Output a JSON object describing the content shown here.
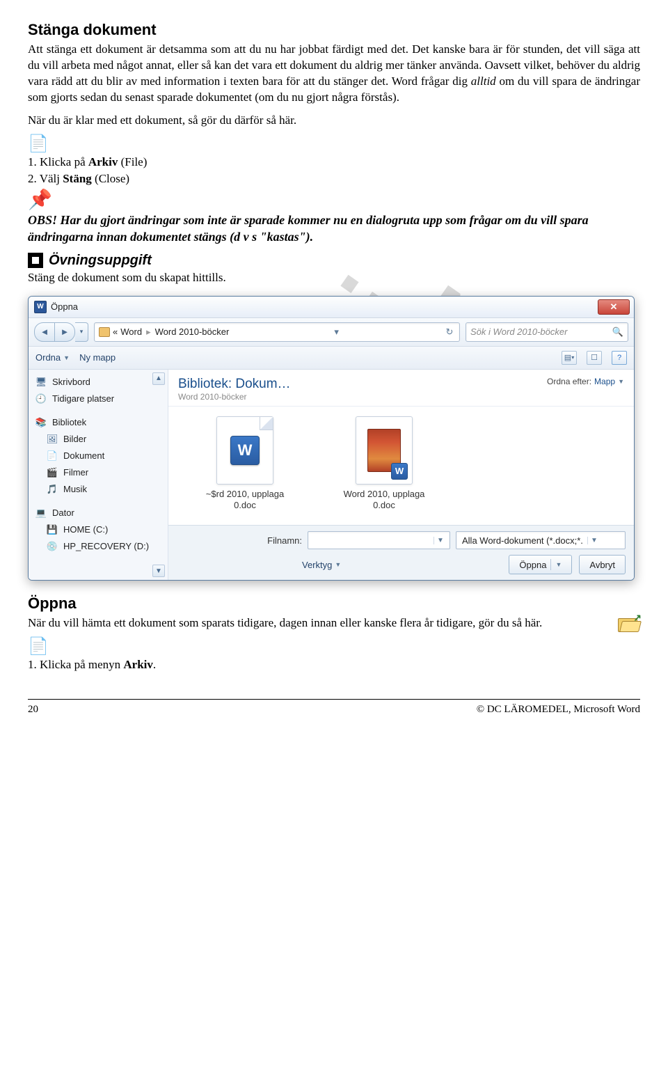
{
  "heading1": "Stänga dokument",
  "para1_a": "Att stänga ett dokument är detsamma som att du nu har jobbat färdigt med det. Det kanske bara är för stunden, det vill säga att du vill arbeta med något annat, eller så kan det vara ett dokument du aldrig mer tänker använda. Oavsett vilket, behöver du aldrig vara rädd att du blir av med information i texten bara för att du stänger det. Word frågar dig ",
  "para1_italic": "alltid",
  "para1_b": " om du vill spara de ändringar som gjorts sedan du senast sparade dokumentet (om du nu gjort några förstås).",
  "para2": "När du är klar med ett dokument, så gör du därför så här.",
  "step1_a": "1. Klicka på ",
  "step1_b": "Arkiv",
  "step1_c": " (File)",
  "step2_a": "2. Välj ",
  "step2_b": "Stäng",
  "step2_c": " (Close)",
  "obs": "OBS! Har du gjort ändringar som inte är sparade kommer nu en dialogruta upp som frågar om du vill spara ändringarna innan dokumentet stängs (d v s \"kastas\").",
  "ovning_label": "Övningsuppgift",
  "ovning_text": "Stäng de dokument som du skapat hittills.",
  "watermark": "...NING",
  "dialog": {
    "title": "Öppna",
    "breadcrumb": {
      "pre": "«",
      "p1": "Word",
      "p2": "Word 2010-böcker"
    },
    "search_placeholder": "Sök i Word 2010-böcker",
    "toolbar": {
      "ordna": "Ordna",
      "ny_mapp": "Ny mapp"
    },
    "sidebar": [
      {
        "icon": "🖥",
        "label": "Skrivbord"
      },
      {
        "icon": "🕘",
        "label": "Tidigare platser"
      },
      {
        "icon": "📚",
        "label": "Bibliotek"
      },
      {
        "icon": "🖼",
        "label": "Bilder"
      },
      {
        "icon": "📄",
        "label": "Dokument"
      },
      {
        "icon": "🎬",
        "label": "Filmer"
      },
      {
        "icon": "🎵",
        "label": "Musik"
      },
      {
        "icon": "💻",
        "label": "Dator"
      },
      {
        "icon": "💾",
        "label": "HOME (C:)"
      },
      {
        "icon": "💿",
        "label": "HP_RECOVERY (D:)"
      }
    ],
    "lib_title": "Bibliotek: Dokum…",
    "lib_sub": "Word 2010-böcker",
    "sort_label": "Ordna efter:",
    "sort_value": "Mapp",
    "files": [
      {
        "name": "~$rd 2010, upplaga 0.doc"
      },
      {
        "name": "Word 2010, upplaga 0.doc"
      }
    ],
    "filename_label": "Filnamn:",
    "filter": "Alla Word-dokument (*.docx;*.",
    "verktyg": "Verktyg",
    "open": "Öppna",
    "cancel": "Avbryt"
  },
  "heading2": "Öppna",
  "para3": "När du vill hämta ett dokument som sparats tidigare, dagen innan eller kanske flera år tidigare, gör du så här.",
  "step_open_a": "1. Klicka på menyn ",
  "step_open_b": "Arkiv",
  "step_open_c": ".",
  "footer": {
    "page": "20",
    "copyright": "© DC LÄROMEDEL, Microsoft Word"
  }
}
